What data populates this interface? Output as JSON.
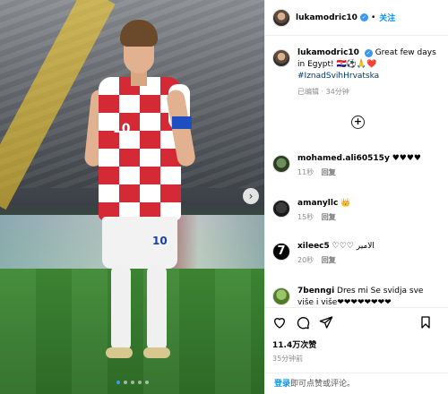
{
  "header": {
    "username": "lukamodric10",
    "separator": "•",
    "follow_label": "关注"
  },
  "caption": {
    "username": "lukamodric10",
    "text": "Great few days in Egypt!",
    "emojis": "🇭🇷⚽🙏❤️",
    "hashtag": "#IznadSvihHrvatska",
    "meta": "已编辑 · 34分钟"
  },
  "load_more_icon": "plus-circle-icon",
  "comments": [
    {
      "username": "mohamed.ali60515y",
      "text": "♥♥♥♥",
      "time": "11秒",
      "reply": "回复"
    },
    {
      "username": "amanyllc",
      "text": "👑",
      "time": "15秒",
      "reply": "回复"
    },
    {
      "username": "xileec5",
      "text": "♡♡♡ الامير",
      "time": "20秒",
      "reply": "回复"
    },
    {
      "username": "7benngi",
      "text": "Dres mi Se svidja sve više i više❤❤❤❤❤❤❤❤",
      "time": "",
      "reply": ""
    }
  ],
  "actions": {
    "likes": "11.4万次赞",
    "time": "35分钟前"
  },
  "login": {
    "link": "登录",
    "text": "即可点赞或评论。"
  },
  "media": {
    "jersey_number": "10",
    "shorts_number": "10"
  },
  "colors": {
    "accent": "#0095f6",
    "verified": "#3897f0",
    "croatia_red": "#d42a36"
  }
}
